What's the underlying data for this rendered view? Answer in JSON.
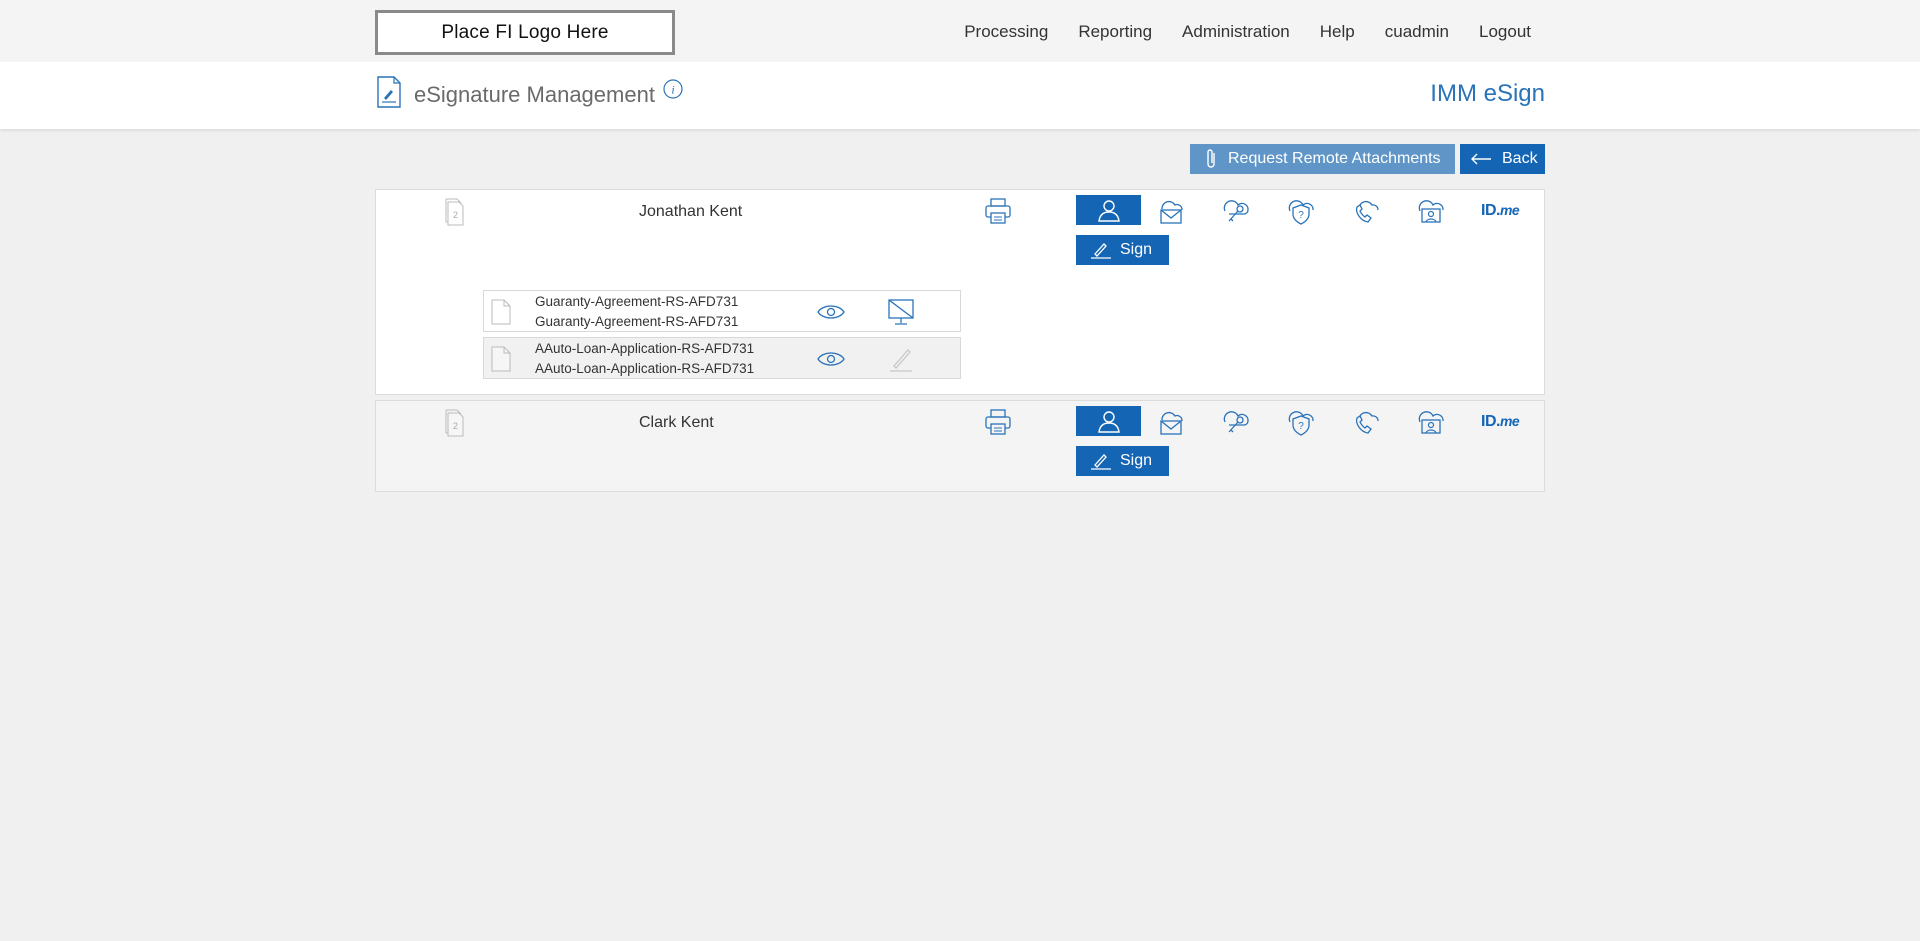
{
  "logo_placeholder": "Place FI Logo Here",
  "nav": [
    "Processing",
    "Reporting",
    "Administration",
    "Help",
    "cuadmin",
    "Logout"
  ],
  "header": {
    "title": "eSignature Management",
    "brand": "IMM eSign"
  },
  "actions": {
    "request_attachments": "Request Remote Attachments",
    "back": "Back"
  },
  "signers": [
    {
      "name": "Jonathan Kent",
      "document_count": "2",
      "sign_label": "Sign",
      "auth_idme_label": "ID.",
      "auth_idme_suffix": "me",
      "documents": [
        {
          "line1": "Guaranty-Agreement-RS-AFD731",
          "line2": "Guaranty-Agreement-RS-AFD731",
          "action": "no-screen-icon"
        },
        {
          "line1": "AAuto-Loan-Application-RS-AFD731",
          "line2": "AAuto-Loan-Application-RS-AFD731",
          "action": "pen-disabled-icon"
        }
      ]
    },
    {
      "name": "Clark Kent",
      "document_count": "2",
      "sign_label": "Sign",
      "auth_idme_label": "ID.",
      "auth_idme_suffix": "me",
      "documents": []
    }
  ],
  "colors": {
    "primary": "#1565b5",
    "primary_light": "#5f96c7",
    "brand_text": "#2a73b8",
    "background": "#f0f0f0"
  }
}
